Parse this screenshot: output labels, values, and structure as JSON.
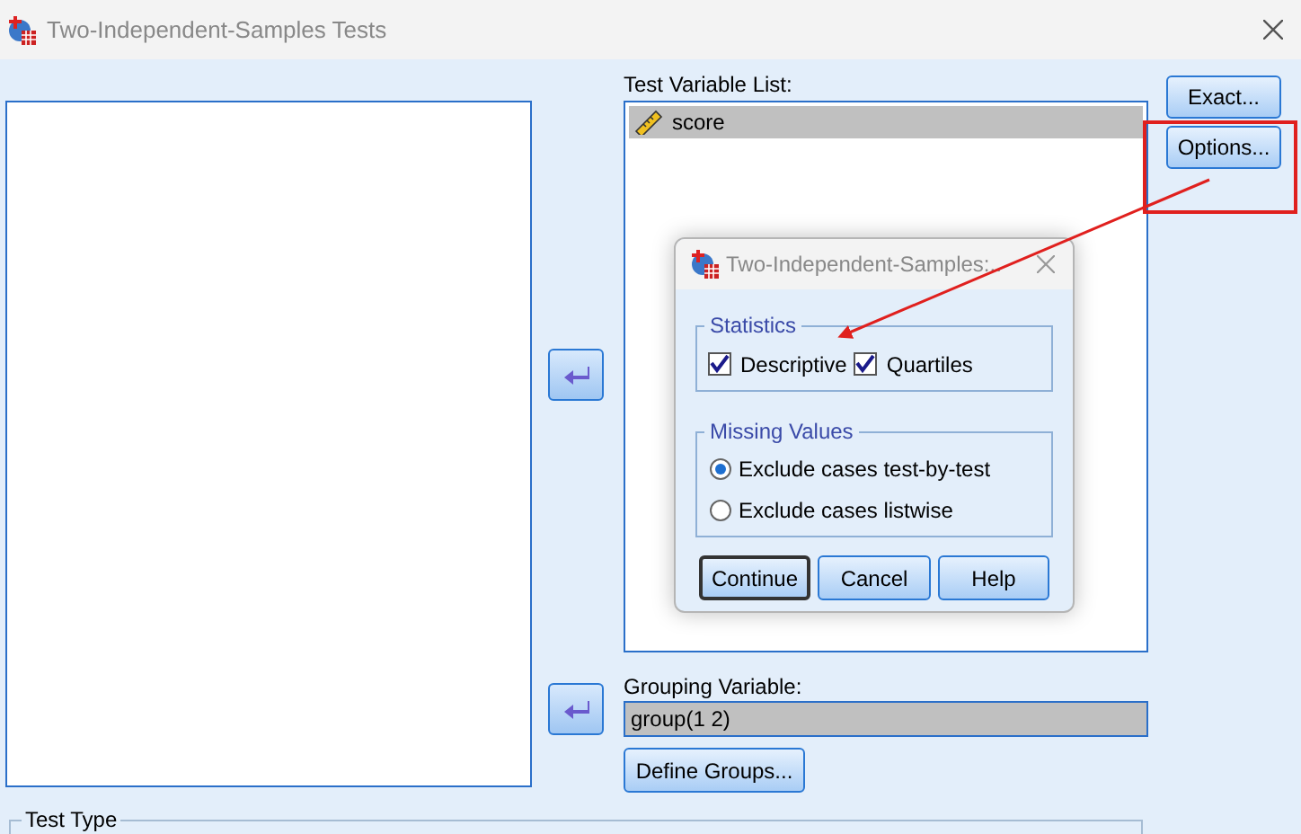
{
  "window": {
    "title": "Two-Independent-Samples Tests"
  },
  "test_variable_list": {
    "label": "Test Variable List:",
    "items": [
      {
        "name": "score",
        "selected": true
      }
    ]
  },
  "side_buttons": [
    "Exact...",
    "Options..."
  ],
  "grouping_variable": {
    "label": "Grouping Variable:",
    "value": "group(1 2)"
  },
  "define_groups_button": "Define Groups...",
  "test_type": {
    "label": "Test Type"
  },
  "options_dialog": {
    "title": "Two-Independent-Samples:..",
    "statistics": {
      "label": "Statistics",
      "options": [
        {
          "label": "Descriptive",
          "checked": true
        },
        {
          "label": "Quartiles",
          "checked": true
        }
      ]
    },
    "missing_values": {
      "label": "Missing Values",
      "options": [
        {
          "label": "Exclude cases test-by-test",
          "selected": true
        },
        {
          "label": "Exclude cases listwise",
          "selected": false
        }
      ]
    },
    "buttons": [
      {
        "label": "Continue",
        "default": true
      },
      {
        "label": "Cancel",
        "default": false
      },
      {
        "label": "Help",
        "default": false
      }
    ]
  }
}
